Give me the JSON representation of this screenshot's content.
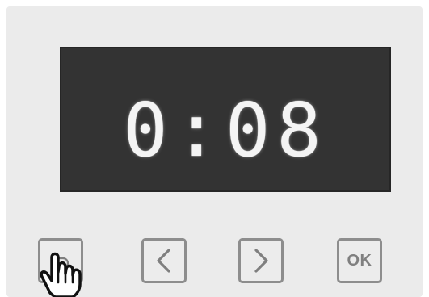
{
  "display": {
    "time": "0:08"
  },
  "buttons": {
    "back": {
      "icon": "back-icon"
    },
    "previous": {
      "icon": "chevron-left-icon"
    },
    "next": {
      "icon": "chevron-right-icon"
    },
    "ok": {
      "label": "OK"
    }
  },
  "cursor": {
    "icon": "hand-pointer-icon"
  },
  "colors": {
    "panel_background": "#ebebeb",
    "display_background": "#333333",
    "display_text": "#f4f4f4",
    "button_border": "#8d8d8d"
  }
}
